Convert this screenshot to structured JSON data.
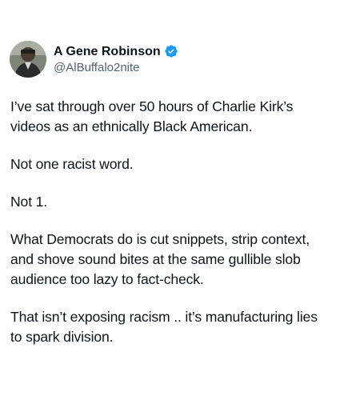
{
  "post": {
    "author": {
      "display_name": "A Gene Robinson",
      "handle": "@AlBuffalo2nite",
      "verified": true,
      "verified_color": "#1d9bf0",
      "avatar_icon": "avatar-photo"
    },
    "paragraphs": [
      "I’ve sat through over 50 hours of Charlie Kirk’s\nvideos as an ethnically Black American.",
      "Not one racist word.",
      "Not 1.",
      "What Democrats do is cut snippets, strip context,\nand shove sound bites at the same gullible slob\naudience too lazy to fact-check.",
      "That isn’t exposing racism .. it’s manufacturing lies\nto spark division."
    ]
  },
  "colors": {
    "text": "#0f1419",
    "secondary_text": "#536471",
    "background": "#ffffff"
  }
}
